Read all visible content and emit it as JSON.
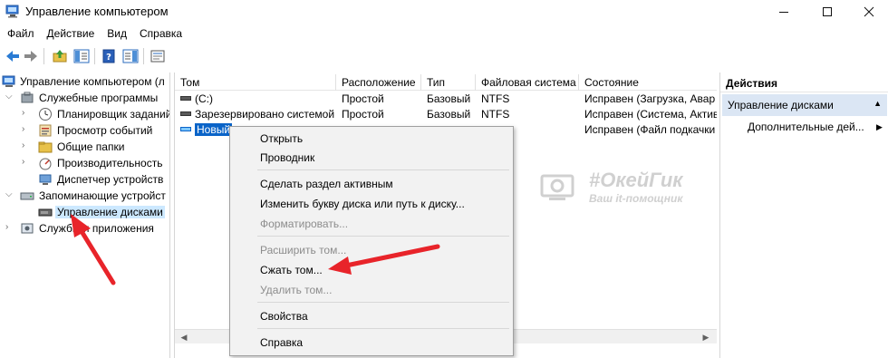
{
  "window": {
    "title": "Управление компьютером"
  },
  "menu": [
    "Файл",
    "Действие",
    "Вид",
    "Справка"
  ],
  "tree": {
    "root": "Управление компьютером (л",
    "items": [
      {
        "label": "Служебные программы",
        "icon": "tools-icon"
      },
      {
        "label": "Планировщик заданий",
        "icon": "clock-icon"
      },
      {
        "label": "Просмотр событий",
        "icon": "event-viewer-icon"
      },
      {
        "label": "Общие папки",
        "icon": "shared-folder-icon"
      },
      {
        "label": "Производительность",
        "icon": "performance-icon"
      },
      {
        "label": "Диспетчер устройств",
        "icon": "device-manager-icon"
      },
      {
        "label": "Запоминающие устройст",
        "icon": "storage-icon"
      },
      {
        "label": "Управление дисками",
        "icon": "disk-icon"
      },
      {
        "label": "Службы и приложения",
        "icon": "services-icon"
      }
    ]
  },
  "list": {
    "columns": [
      "Том",
      "Расположение",
      "Тип",
      "Файловая система",
      "Состояние"
    ],
    "rows": [
      {
        "volume": "(C:)",
        "layout": "Простой",
        "type": "Базовый",
        "fs": "NTFS",
        "status": "Исправен (Загрузка, Авар"
      },
      {
        "volume": "Зарезервировано системой",
        "layout": "Простой",
        "type": "Базовый",
        "fs": "NTFS",
        "status": "Исправен (Система, Актив"
      },
      {
        "volume": "Новый",
        "layout": "",
        "type": "",
        "fs": "",
        "status": "Исправен (Файл подкачки"
      }
    ]
  },
  "actions": {
    "header": "Действия",
    "section": "Управление дисками",
    "item": "Дополнительные дей..."
  },
  "context_menu": {
    "open": "Открыть",
    "explorer": "Проводник",
    "mark_active": "Сделать раздел активным",
    "change_letter": "Изменить букву диска или путь к диску...",
    "format": "Форматировать...",
    "extend": "Расширить том...",
    "shrink": "Сжать том...",
    "delete": "Удалить том...",
    "properties": "Свойства",
    "help": "Справка"
  },
  "watermark": {
    "title": "#ОкейГик",
    "subtitle": "Ваш it-помощник"
  },
  "colors": {
    "selection": "#0a64c8",
    "tree_selection": "#cce8ff",
    "actions_section": "#dbe6f4",
    "annotation_arrow": "#e8242a"
  }
}
